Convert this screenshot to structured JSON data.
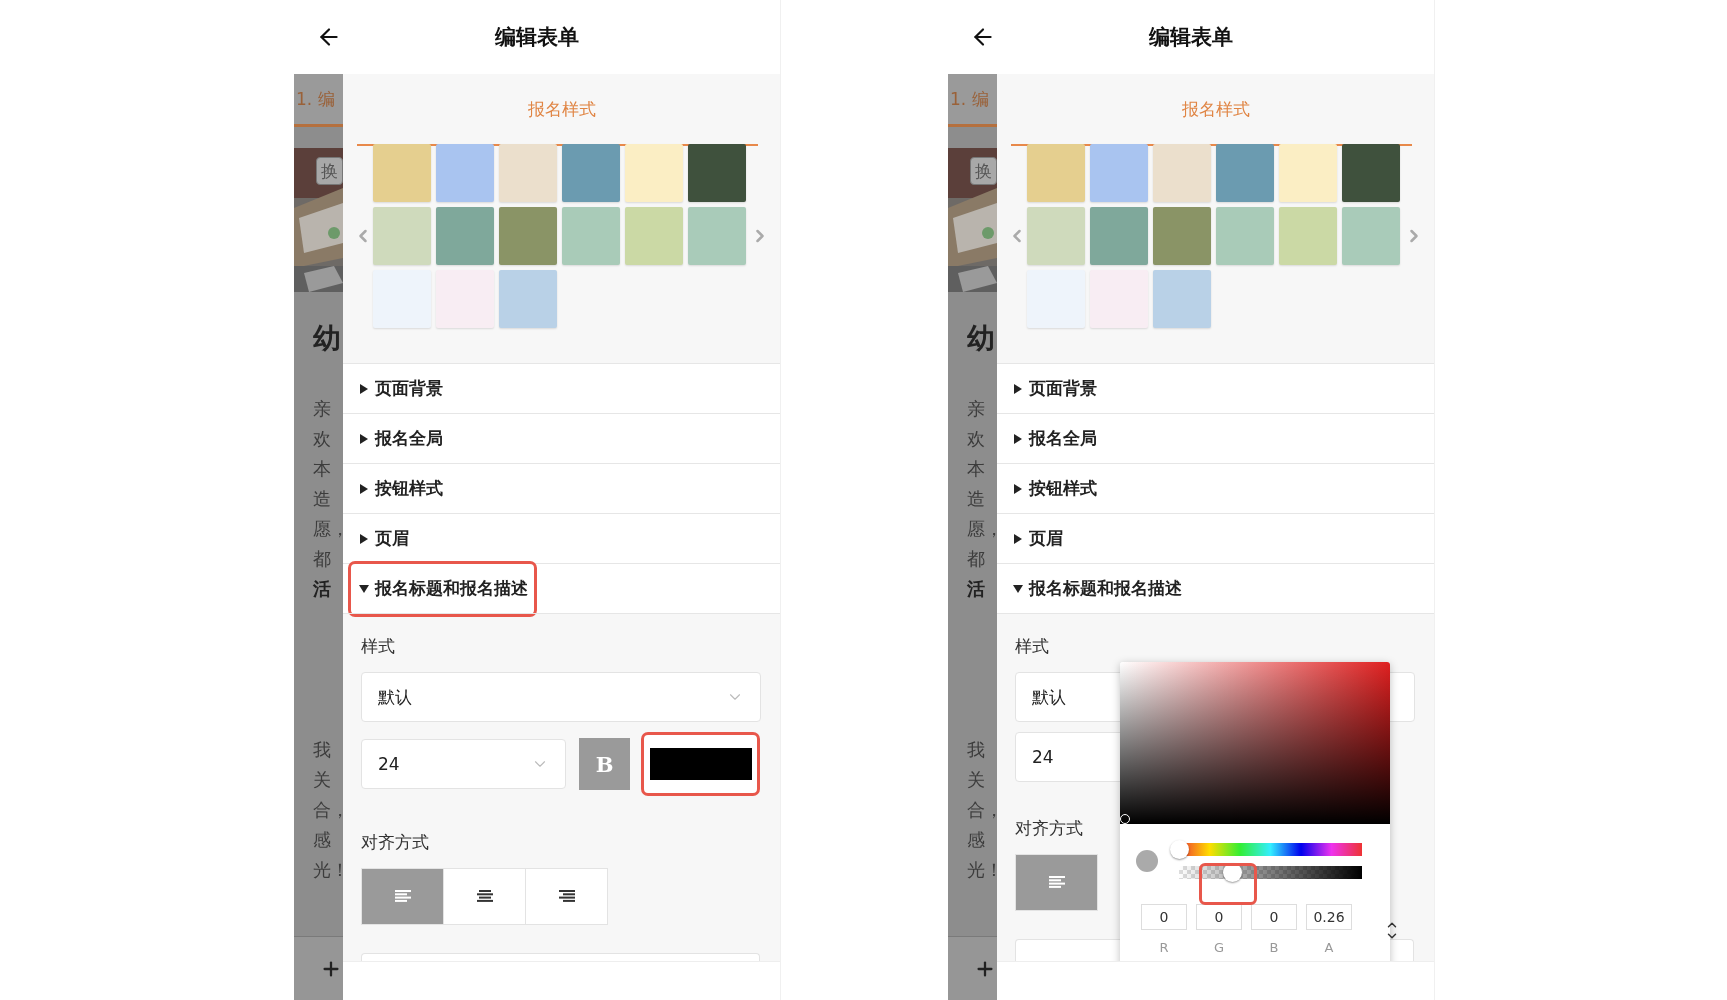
{
  "phones": [
    {
      "header": {
        "title": "编辑表单"
      },
      "background_page": {
        "step_tab": "1. 编",
        "photo_button": "换",
        "heading": "幼",
        "lines_a": [
          {
            "text": "亲",
            "bold": false
          },
          {
            "text": "欢",
            "bold": false
          },
          {
            "text": "本",
            "bold": false
          },
          {
            "text": "造",
            "bold": false
          },
          {
            "text": "愿，",
            "bold": false
          },
          {
            "text": "都",
            "bold": false
          },
          {
            "text": "活",
            "bold": true
          }
        ],
        "lines_b": [
          {
            "text": "我",
            "bold": false
          },
          {
            "text": "关",
            "bold": false
          },
          {
            "text": "合，",
            "bold": false
          },
          {
            "text": "感",
            "bold": false
          },
          {
            "text": "光！",
            "bold": false
          }
        ]
      },
      "panel": {
        "title": "报名样式",
        "swatches": [
          {
            "color": "#e5cf8f"
          },
          {
            "color": "#a9c4f0"
          },
          {
            "color": "#ebdfcc"
          },
          {
            "color": "#6b9bb0"
          },
          {
            "color": "#fbeec4"
          },
          {
            "color": "#3f513d"
          },
          {
            "color": "#cfdabc"
          },
          {
            "color": "#7fa89b"
          },
          {
            "color": "#8a9466"
          },
          {
            "color": "#a9cbb8"
          },
          {
            "color": "#cbd9a5"
          },
          {
            "color": "#a9cbb9"
          },
          {
            "color": "#eef4fb"
          },
          {
            "color": "#f8edf3"
          },
          {
            "color": "#b9d1e7"
          }
        ],
        "sections": [
          {
            "label": "页面背景",
            "expanded": false,
            "highlighted": false
          },
          {
            "label": "报名全局",
            "expanded": false,
            "highlighted": false
          },
          {
            "label": "按钮样式",
            "expanded": false,
            "highlighted": false
          },
          {
            "label": "页眉",
            "expanded": false,
            "highlighted": false
          },
          {
            "label": "报名标题和报名描述",
            "expanded": true,
            "highlighted": true
          }
        ],
        "style_label": "样式",
        "style_select": {
          "value": "默认"
        },
        "size_select": {
          "value": "24"
        },
        "bold_button": {
          "label": "B"
        },
        "color_field": {
          "color": "#000000",
          "highlighted": true
        },
        "align_label": "对齐方式",
        "align_options": [
          {
            "kind": "left",
            "selected": true
          },
          {
            "kind": "center",
            "selected": false
          },
          {
            "kind": "right",
            "selected": false
          }
        ]
      }
    },
    {
      "header": {
        "title": "编辑表单"
      },
      "background_page": {
        "step_tab": "1. 编",
        "photo_button": "换",
        "heading": "幼",
        "lines_a": [
          {
            "text": "亲",
            "bold": false
          },
          {
            "text": "欢",
            "bold": false
          },
          {
            "text": "本",
            "bold": false
          },
          {
            "text": "造",
            "bold": false
          },
          {
            "text": "愿，",
            "bold": false
          },
          {
            "text": "都",
            "bold": false
          },
          {
            "text": "活",
            "bold": true
          }
        ],
        "lines_b": [
          {
            "text": "我",
            "bold": false
          },
          {
            "text": "关",
            "bold": false
          },
          {
            "text": "合，",
            "bold": false
          },
          {
            "text": "感",
            "bold": false
          },
          {
            "text": "光！",
            "bold": false
          }
        ]
      },
      "panel": {
        "title": "报名样式",
        "swatches": [
          {
            "color": "#e5cf8f"
          },
          {
            "color": "#a9c4f0"
          },
          {
            "color": "#ebdfcc"
          },
          {
            "color": "#6b9bb0"
          },
          {
            "color": "#fbeec4"
          },
          {
            "color": "#3f513d"
          },
          {
            "color": "#cfdabc"
          },
          {
            "color": "#7fa89b"
          },
          {
            "color": "#8a9466"
          },
          {
            "color": "#a9cbb8"
          },
          {
            "color": "#cbd9a5"
          },
          {
            "color": "#a9cbb9"
          },
          {
            "color": "#eef4fb"
          },
          {
            "color": "#f8edf3"
          },
          {
            "color": "#b9d1e7"
          }
        ],
        "sections": [
          {
            "label": "页面背景",
            "expanded": false,
            "highlighted": false
          },
          {
            "label": "报名全局",
            "expanded": false,
            "highlighted": false
          },
          {
            "label": "按钮样式",
            "expanded": false,
            "highlighted": false
          },
          {
            "label": "页眉",
            "expanded": false,
            "highlighted": false
          },
          {
            "label": "报名标题和报名描述",
            "expanded": true,
            "highlighted": false
          }
        ],
        "style_label": "样式",
        "style_select": {
          "value": "默认"
        },
        "size_select": {
          "value": "24"
        },
        "align_label": "对齐方式",
        "align_options": [
          {
            "kind": "left",
            "selected": true
          }
        ],
        "color_picker": {
          "hue_slider": {
            "level": 0
          },
          "alpha_slider": {
            "level": 0.26,
            "highlighted": true
          },
          "inputs": [
            {
              "label": "R",
              "value": "0"
            },
            {
              "label": "G",
              "value": "0"
            },
            {
              "label": "B",
              "value": "0"
            },
            {
              "label": "A",
              "value": "0.26"
            }
          ]
        }
      }
    }
  ]
}
